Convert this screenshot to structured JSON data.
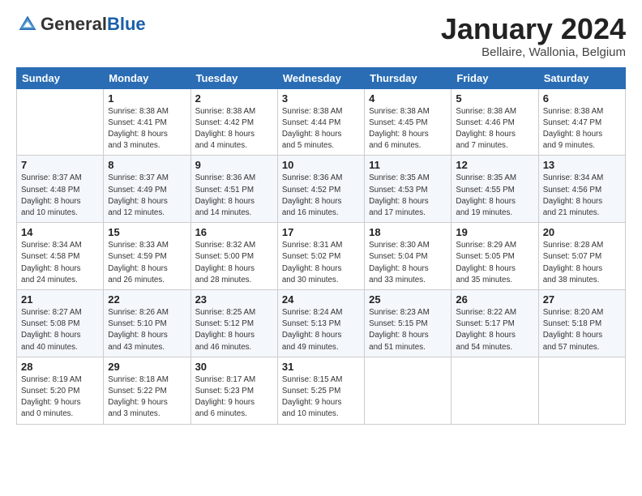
{
  "header": {
    "logo_general": "General",
    "logo_blue": "Blue",
    "month_title": "January 2024",
    "subtitle": "Bellaire, Wallonia, Belgium"
  },
  "weekdays": [
    "Sunday",
    "Monday",
    "Tuesday",
    "Wednesday",
    "Thursday",
    "Friday",
    "Saturday"
  ],
  "weeks": [
    [
      {
        "day": "",
        "info": ""
      },
      {
        "day": "1",
        "info": "Sunrise: 8:38 AM\nSunset: 4:41 PM\nDaylight: 8 hours\nand 3 minutes."
      },
      {
        "day": "2",
        "info": "Sunrise: 8:38 AM\nSunset: 4:42 PM\nDaylight: 8 hours\nand 4 minutes."
      },
      {
        "day": "3",
        "info": "Sunrise: 8:38 AM\nSunset: 4:44 PM\nDaylight: 8 hours\nand 5 minutes."
      },
      {
        "day": "4",
        "info": "Sunrise: 8:38 AM\nSunset: 4:45 PM\nDaylight: 8 hours\nand 6 minutes."
      },
      {
        "day": "5",
        "info": "Sunrise: 8:38 AM\nSunset: 4:46 PM\nDaylight: 8 hours\nand 7 minutes."
      },
      {
        "day": "6",
        "info": "Sunrise: 8:38 AM\nSunset: 4:47 PM\nDaylight: 8 hours\nand 9 minutes."
      }
    ],
    [
      {
        "day": "7",
        "info": "Sunrise: 8:37 AM\nSunset: 4:48 PM\nDaylight: 8 hours\nand 10 minutes."
      },
      {
        "day": "8",
        "info": "Sunrise: 8:37 AM\nSunset: 4:49 PM\nDaylight: 8 hours\nand 12 minutes."
      },
      {
        "day": "9",
        "info": "Sunrise: 8:36 AM\nSunset: 4:51 PM\nDaylight: 8 hours\nand 14 minutes."
      },
      {
        "day": "10",
        "info": "Sunrise: 8:36 AM\nSunset: 4:52 PM\nDaylight: 8 hours\nand 16 minutes."
      },
      {
        "day": "11",
        "info": "Sunrise: 8:35 AM\nSunset: 4:53 PM\nDaylight: 8 hours\nand 17 minutes."
      },
      {
        "day": "12",
        "info": "Sunrise: 8:35 AM\nSunset: 4:55 PM\nDaylight: 8 hours\nand 19 minutes."
      },
      {
        "day": "13",
        "info": "Sunrise: 8:34 AM\nSunset: 4:56 PM\nDaylight: 8 hours\nand 21 minutes."
      }
    ],
    [
      {
        "day": "14",
        "info": "Sunrise: 8:34 AM\nSunset: 4:58 PM\nDaylight: 8 hours\nand 24 minutes."
      },
      {
        "day": "15",
        "info": "Sunrise: 8:33 AM\nSunset: 4:59 PM\nDaylight: 8 hours\nand 26 minutes."
      },
      {
        "day": "16",
        "info": "Sunrise: 8:32 AM\nSunset: 5:00 PM\nDaylight: 8 hours\nand 28 minutes."
      },
      {
        "day": "17",
        "info": "Sunrise: 8:31 AM\nSunset: 5:02 PM\nDaylight: 8 hours\nand 30 minutes."
      },
      {
        "day": "18",
        "info": "Sunrise: 8:30 AM\nSunset: 5:04 PM\nDaylight: 8 hours\nand 33 minutes."
      },
      {
        "day": "19",
        "info": "Sunrise: 8:29 AM\nSunset: 5:05 PM\nDaylight: 8 hours\nand 35 minutes."
      },
      {
        "day": "20",
        "info": "Sunrise: 8:28 AM\nSunset: 5:07 PM\nDaylight: 8 hours\nand 38 minutes."
      }
    ],
    [
      {
        "day": "21",
        "info": "Sunrise: 8:27 AM\nSunset: 5:08 PM\nDaylight: 8 hours\nand 40 minutes."
      },
      {
        "day": "22",
        "info": "Sunrise: 8:26 AM\nSunset: 5:10 PM\nDaylight: 8 hours\nand 43 minutes."
      },
      {
        "day": "23",
        "info": "Sunrise: 8:25 AM\nSunset: 5:12 PM\nDaylight: 8 hours\nand 46 minutes."
      },
      {
        "day": "24",
        "info": "Sunrise: 8:24 AM\nSunset: 5:13 PM\nDaylight: 8 hours\nand 49 minutes."
      },
      {
        "day": "25",
        "info": "Sunrise: 8:23 AM\nSunset: 5:15 PM\nDaylight: 8 hours\nand 51 minutes."
      },
      {
        "day": "26",
        "info": "Sunrise: 8:22 AM\nSunset: 5:17 PM\nDaylight: 8 hours\nand 54 minutes."
      },
      {
        "day": "27",
        "info": "Sunrise: 8:20 AM\nSunset: 5:18 PM\nDaylight: 8 hours\nand 57 minutes."
      }
    ],
    [
      {
        "day": "28",
        "info": "Sunrise: 8:19 AM\nSunset: 5:20 PM\nDaylight: 9 hours\nand 0 minutes."
      },
      {
        "day": "29",
        "info": "Sunrise: 8:18 AM\nSunset: 5:22 PM\nDaylight: 9 hours\nand 3 minutes."
      },
      {
        "day": "30",
        "info": "Sunrise: 8:17 AM\nSunset: 5:23 PM\nDaylight: 9 hours\nand 6 minutes."
      },
      {
        "day": "31",
        "info": "Sunrise: 8:15 AM\nSunset: 5:25 PM\nDaylight: 9 hours\nand 10 minutes."
      },
      {
        "day": "",
        "info": ""
      },
      {
        "day": "",
        "info": ""
      },
      {
        "day": "",
        "info": ""
      }
    ]
  ]
}
